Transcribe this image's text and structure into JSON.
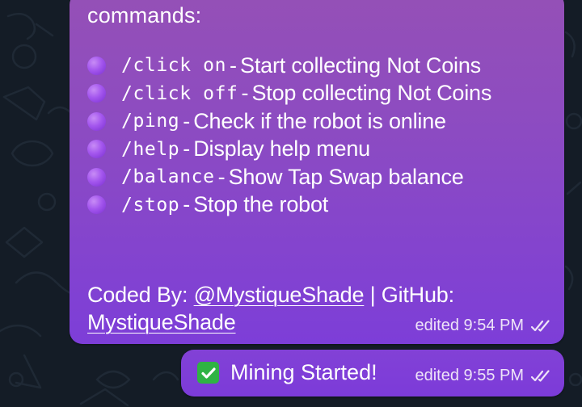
{
  "colors": {
    "chat_background": "#141c26",
    "bubble_purple": "#8c4bc2",
    "check_green": "#2fb344"
  },
  "message_main": {
    "intro": "commands:",
    "commands": [
      {
        "icon": "purple-circle-icon",
        "command": "/click on",
        "separator": "-",
        "description": "Start collecting Not Coins"
      },
      {
        "icon": "purple-circle-icon",
        "command": "/click off",
        "separator": "-",
        "description": "Stop collecting Not Coins"
      },
      {
        "icon": "purple-circle-icon",
        "command": "/ping",
        "separator": "-",
        "description": "Check if the robot is online"
      },
      {
        "icon": "purple-circle-icon",
        "command": "/help",
        "separator": "-",
        "description": "Display help menu"
      },
      {
        "icon": "purple-circle-icon",
        "command": "/balance",
        "separator": "-",
        "description": "Show Tap Swap balance"
      },
      {
        "icon": "purple-circle-icon",
        "command": "/stop",
        "separator": "-",
        "description": "Stop the robot"
      }
    ],
    "footer": {
      "coded_by": "Coded By:",
      "author_handle": "@MystiqueShade",
      "divider": "|",
      "github_label": "GitHub:",
      "github_user": "MystiqueShade"
    },
    "edited_label": "edited 9:54 PM",
    "status_icon": "double-check-icon"
  },
  "message_small": {
    "icon": "check-mark-button-icon",
    "text": "Mining Started!",
    "edited_label": "edited 9:55 PM",
    "status_icon": "double-check-icon"
  }
}
